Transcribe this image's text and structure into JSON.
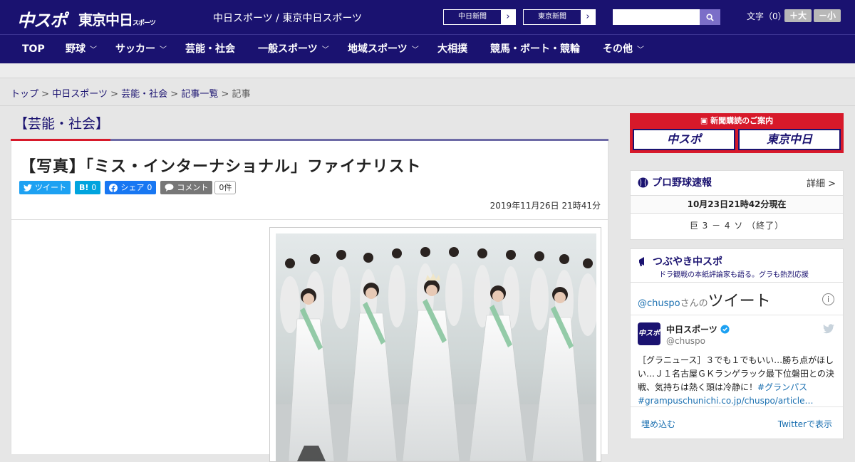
{
  "header": {
    "logo_chuspo": "中スポ",
    "logo_tokyo": "東京中日",
    "logo_tokyo_sub": "スポーツ",
    "site_names": "中日スポーツ / 東京中日スポーツ",
    "btn_chunichi": "中日新聞",
    "btn_tokyo": "東京新聞",
    "font_label": "文字（0）",
    "font_plus": "＋大",
    "font_minus": "－小"
  },
  "nav": [
    "TOP",
    "野球",
    "サッカー",
    "芸能・社会",
    "一般スポーツ",
    "地域スポーツ",
    "大相撲",
    "競馬・ボート・競輪",
    "その他"
  ],
  "breadcrumb": {
    "items": [
      "トップ",
      "中日スポーツ",
      "芸能・社会",
      "記事一覧"
    ],
    "current": "記事",
    "sep": ">"
  },
  "article": {
    "category": "【芸能・社会】",
    "title": "【写真】「ミス・インターナショナル」ファイナリスト",
    "tweet": "ツイート",
    "hatena": "B!",
    "hatena_count": "0",
    "facebook": "シェア",
    "facebook_count": "0",
    "comment": "コメント",
    "comment_count": "0件",
    "date": "2019年11月26日 21時41分"
  },
  "sidebar": {
    "banner_title": "新聞購読のご案内",
    "banner_chuspo": "中スポ",
    "banner_tokyo": "東京中日",
    "baseball": {
      "title": "プロ野球速報",
      "more": "詳細 >",
      "date": "10月23日21時42分現在",
      "score": "巨 3 － 4 ソ （終了）"
    },
    "twitter": {
      "title": "つぶやき中スポ",
      "subtitle": "ドラ観戦の本紙評論家も語る。グラも熱烈応援",
      "head_handle": "@chuspo",
      "head_san": "さんの",
      "head_tweet": "ツイート",
      "account_name": "中日スポーツ",
      "account_handle": "@chuspo",
      "text": "［グラニュース］３でも１でもいい…勝ち点がほしい…Ｊ１名古屋ＧＫランゲラック最下位磐田との決戦、気持ちは熱く頭は冷静に！",
      "hashtag": "#グランパス",
      "link": "#grampuschunichi.co.jp/chuspo/article…",
      "embed": "埋め込む",
      "view": "Twitterで表示"
    }
  },
  "colors": {
    "navy": "#1a1270",
    "red": "#d7192a",
    "twitter": "#1da1f2",
    "hatena": "#00a4de",
    "facebook": "#1877f2"
  }
}
